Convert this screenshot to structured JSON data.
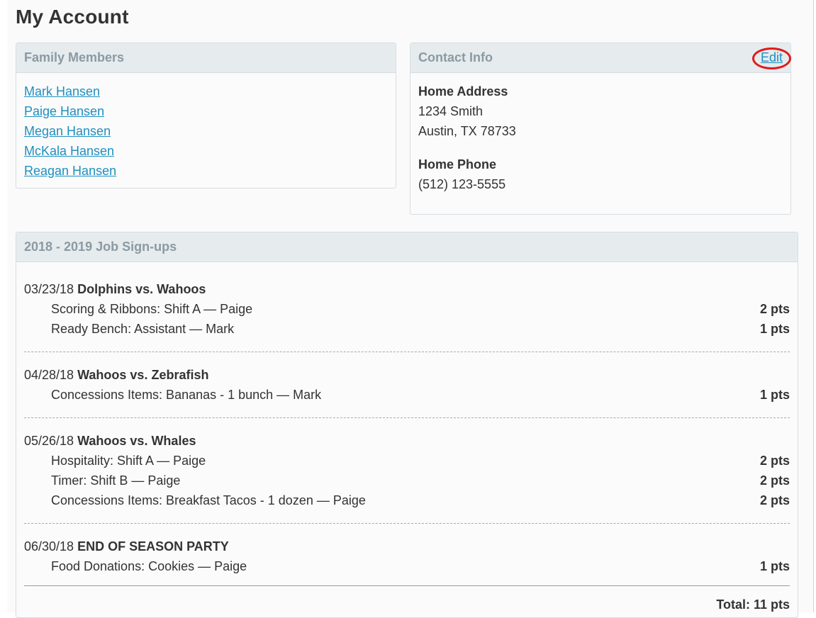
{
  "page": {
    "title": "My Account"
  },
  "family": {
    "heading": "Family Members",
    "members": [
      "Mark Hansen",
      "Paige Hansen",
      "Megan Hansen",
      "McKala Hansen",
      "Reagan Hansen"
    ]
  },
  "contact": {
    "heading": "Contact Info",
    "edit_label": "Edit",
    "address_label": "Home Address",
    "address_line1": "1234 Smith",
    "address_line2": "Austin, TX 78733",
    "phone_label": "Home Phone",
    "phone": "(512) 123-5555"
  },
  "jobs": {
    "heading": "2018 - 2019 Job Sign-ups",
    "events": [
      {
        "date": "03/23/18",
        "name": "Dolphins vs. Wahoos",
        "items": [
          {
            "label": "Scoring & Ribbons: Shift A — Paige",
            "pts": "2 pts"
          },
          {
            "label": "Ready Bench: Assistant — Mark",
            "pts": "1 pts"
          }
        ]
      },
      {
        "date": "04/28/18",
        "name": "Wahoos vs. Zebrafish",
        "items": [
          {
            "label": "Concessions Items: Bananas - 1 bunch — Mark",
            "pts": "1 pts"
          }
        ]
      },
      {
        "date": "05/26/18",
        "name": "Wahoos vs. Whales",
        "items": [
          {
            "label": "Hospitality: Shift A — Paige",
            "pts": "2 pts"
          },
          {
            "label": "Timer: Shift B — Paige",
            "pts": "2 pts"
          },
          {
            "label": "Concessions Items: Breakfast Tacos - 1 dozen — Paige",
            "pts": "2 pts"
          }
        ]
      },
      {
        "date": "06/30/18",
        "name": "END OF SEASON PARTY",
        "items": [
          {
            "label": "Food Donations: Cookies — Paige",
            "pts": "1 pts"
          }
        ]
      }
    ],
    "total": "Total: 11 pts"
  },
  "colors": {
    "link": "#1f8fbf",
    "panel_heading_bg": "#e6ebee",
    "panel_heading_text": "#8a9aa3",
    "highlight_circle": "#e01a1a"
  }
}
